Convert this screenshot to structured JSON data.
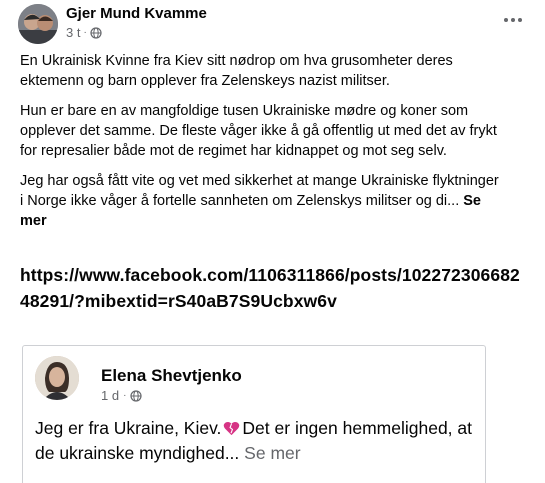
{
  "post": {
    "author": "Gjer Mund Kvamme",
    "time": "3 t",
    "separator": "·",
    "paragraphs": [
      "En Ukrainisk Kvinne fra Kiev sitt nødrop om hva grusomheter deres ektemenn og barn opplever fra Zelenskeys nazist militser.",
      "Hun er bare en av mangfoldige tusen Ukrainiske mødre og koner som opplever det samme. De fleste våger ikke å gå offentlig ut med det av frykt for represalier både mot de regimet har kidnappet og mot seg selv."
    ],
    "last_paragraph": "Jeg har også fått vite og vet med sikkerhet at mange Ukrainiske flyktninger i Norge ikke våger å fortelle sannheten om Zelenskys militser og di...",
    "see_more": "Se mer",
    "link": "https://www.facebook.com/1106311866/posts/10227230668248291/?mibextid=rS40aB7S9Ucbxw6v"
  },
  "shared": {
    "author": "Elena Shevtjenko",
    "time": "1 d",
    "separator": "·",
    "text_before_heart": "Jeg er fra Ukraine, Kiev.",
    "text_after_heart": "Det er ingen hemmelighed, at de ukrainske myndighed...",
    "see_more": "Se mer"
  },
  "icons": {
    "globe": "globe-icon",
    "more": "more-options-icon",
    "heart": "broken-heart-icon"
  },
  "colors": {
    "secondary_text": "#65676b",
    "heart": "#d63384"
  }
}
